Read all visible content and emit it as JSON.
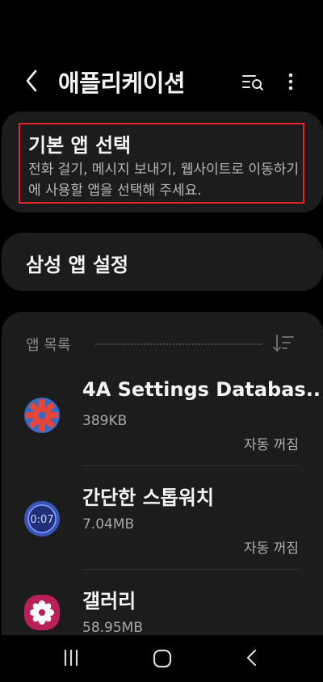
{
  "header": {
    "title": "애플리케이션",
    "back_icon": "back-chevron-icon",
    "search_list_icon": "search-list-icon",
    "more_icon": "more-vertical-icon"
  },
  "default_apps": {
    "title": "기본 앱 선택",
    "description": "전화 걸기, 메시지 보내기, 웹사이트로 이동하기에 사용할 앱을 선택해 주세요.",
    "highlight_color": "#e5222b"
  },
  "samsung_settings": {
    "label": "삼성 앱 설정"
  },
  "app_list": {
    "section_label": "앱 목록",
    "sort_icon": "sort-icon",
    "apps": [
      {
        "name": "4A Settings Databas..",
        "size": "389KB",
        "status": "자동 꺼짐",
        "icon": "settings-database-icon"
      },
      {
        "name": "간단한 스톱워치",
        "size": "7.04MB",
        "status": "자동 꺼짐",
        "icon": "stopwatch-icon"
      },
      {
        "name": "갤러리",
        "size": "58.95MB",
        "status": "",
        "icon": "gallery-flower-icon"
      }
    ]
  },
  "navbar": {
    "recent_icon": "recent-apps-icon",
    "home_icon": "home-icon",
    "back_icon": "back-icon"
  },
  "colors": {
    "background": "#000000",
    "card": "#1c1c1c",
    "accent_red": "#e5222b"
  }
}
